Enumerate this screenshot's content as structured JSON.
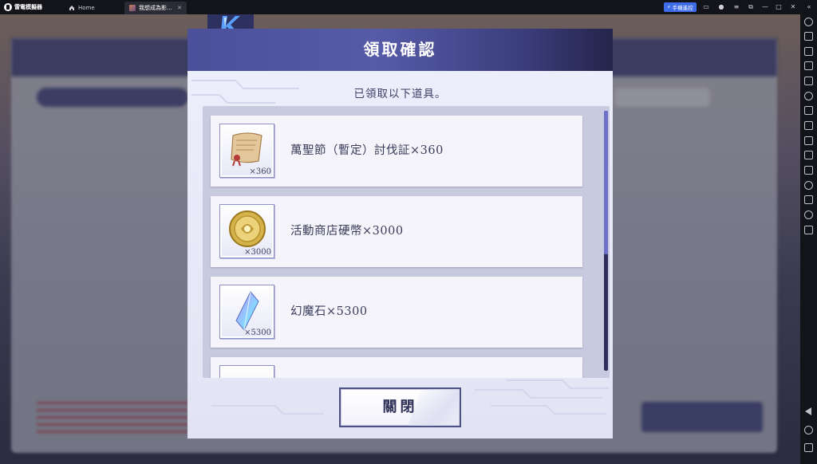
{
  "titlebar": {
    "app_name": "雷電模擬器",
    "tabs": [
      {
        "label": "Home"
      },
      {
        "label": "我想成為影..."
      }
    ],
    "remote_button": "手機遙控"
  },
  "dialog": {
    "title": "領取確認",
    "subtitle": "已領取以下道具。",
    "items": [
      {
        "name": "萬聖節（暫定）討伐証×360",
        "count": "×360",
        "icon": "scroll-icon"
      },
      {
        "name": "活動商店硬幣×3000",
        "count": "×3000",
        "icon": "coin-icon"
      },
      {
        "name": "幻魔石×5300",
        "count": "×5300",
        "icon": "crystal-icon"
      }
    ],
    "close_label": "關閉"
  },
  "colors": {
    "header_start": "#4b5099",
    "header_end": "#24254a",
    "body_bg": "#eceefc",
    "scroll_thumb": "#6d72c8"
  }
}
